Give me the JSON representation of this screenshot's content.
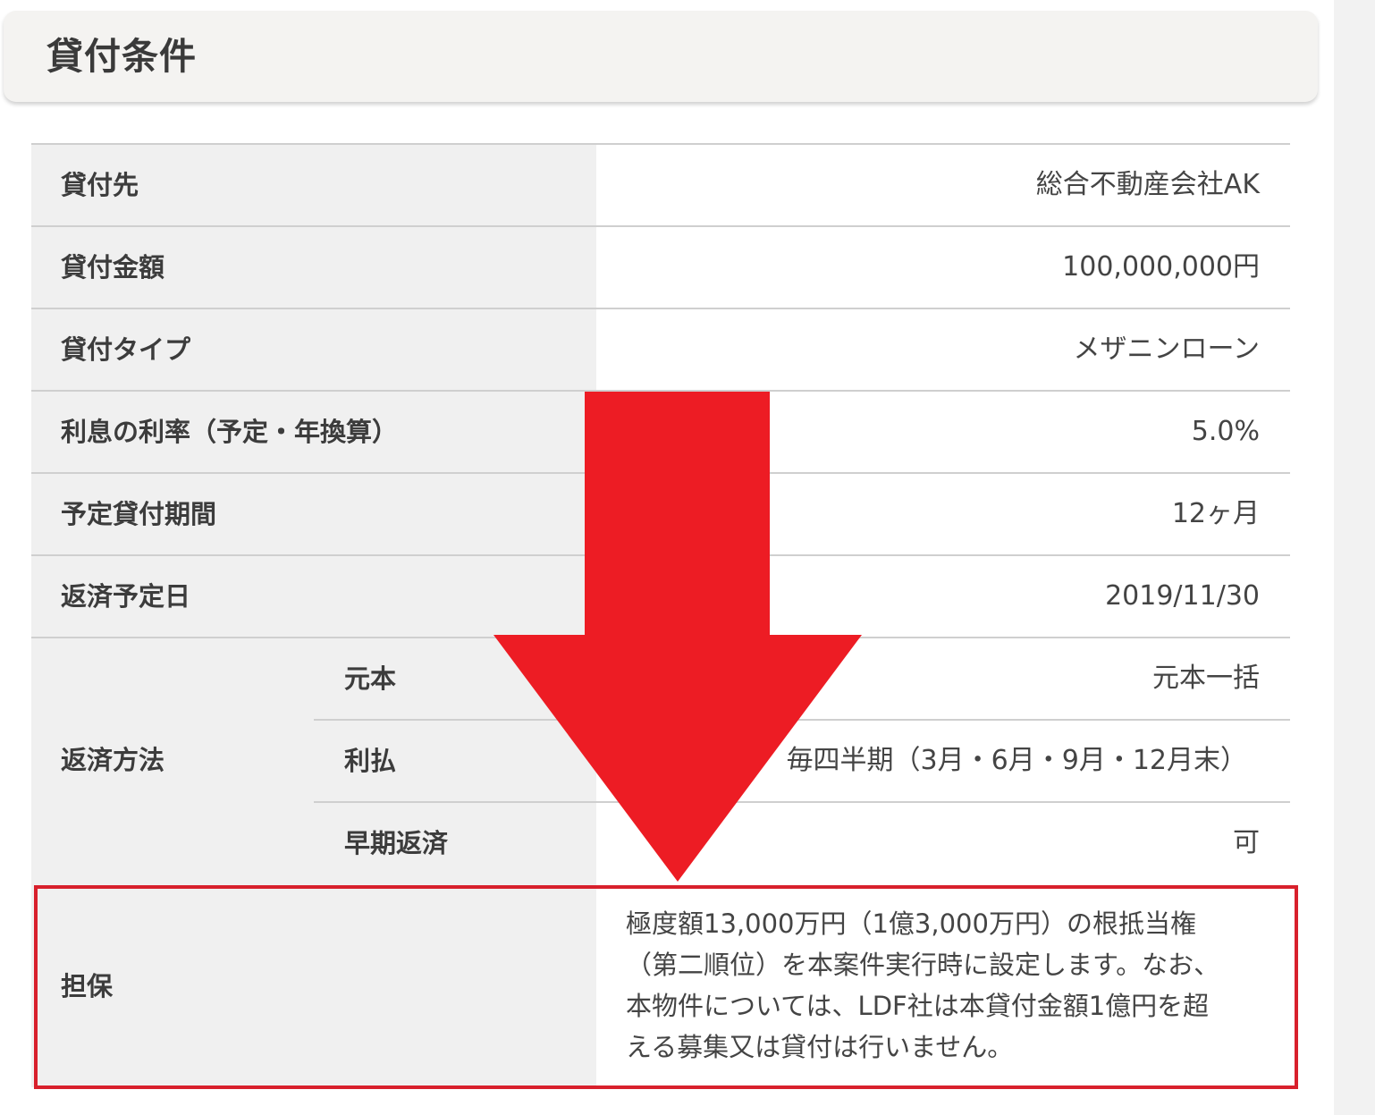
{
  "section": {
    "title": "貸付条件"
  },
  "rows": [
    {
      "label": "貸付先",
      "value": "総合不動産会社AK"
    },
    {
      "label": "貸付金額",
      "value": "100,000,000円"
    },
    {
      "label": "貸付タイプ",
      "value": "メザニンローン"
    },
    {
      "label": "利息の利率（予定・年換算）",
      "value": "5.0%"
    },
    {
      "label": "予定貸付期間",
      "value": "12ヶ月"
    },
    {
      "label": "返済予定日",
      "value": "2019/11/30"
    }
  ],
  "repayment": {
    "label": "返済方法",
    "items": [
      {
        "label": "元本",
        "value": "元本一括"
      },
      {
        "label": "利払",
        "value": "毎四半期（3月・6月・9月・12月末）"
      },
      {
        "label": "早期返済",
        "value": "可"
      }
    ]
  },
  "collateral": {
    "label": "担保",
    "lines": [
      "極度額13,000万円（1億3,000万円）の根抵当権",
      "（第二順位）を本案件実行時に設定します。なお、",
      "本物件については、LDF社は本貸付金額1億円を超",
      "える募集又は貸付は行いません。"
    ]
  },
  "annotation": {
    "arrow_color": "#ed1c24",
    "box_color": "#d8202c",
    "arrow_icon": "down-arrow-icon"
  }
}
